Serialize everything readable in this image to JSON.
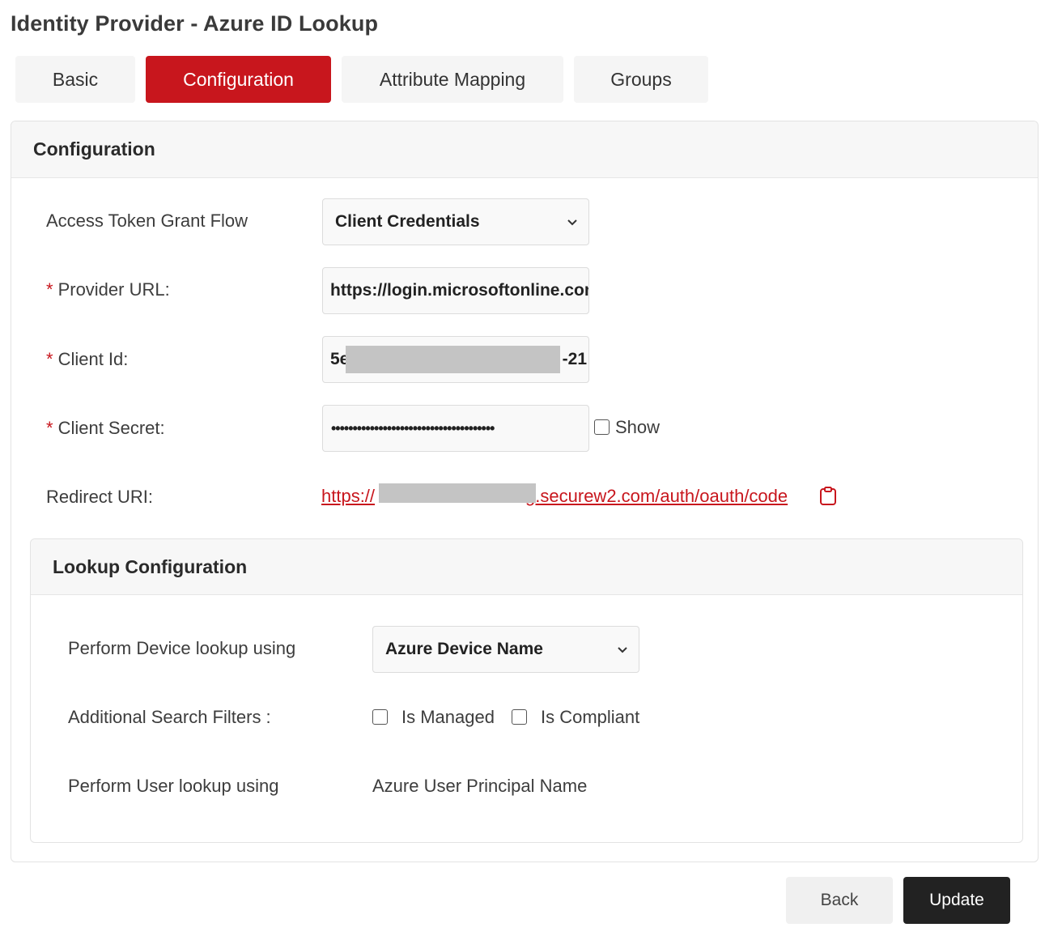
{
  "page": {
    "title": "Identity Provider - Azure ID Lookup"
  },
  "tabs": [
    {
      "label": "Basic",
      "active": false
    },
    {
      "label": "Configuration",
      "active": true
    },
    {
      "label": "Attribute Mapping",
      "active": false
    },
    {
      "label": "Groups",
      "active": false
    }
  ],
  "configuration": {
    "header": "Configuration",
    "grant_flow": {
      "label": "Access Token Grant Flow",
      "value": "Client Credentials"
    },
    "provider_url": {
      "required_mark": "*",
      "label": "Provider URL:",
      "value": "https://login.microsoftonline.com"
    },
    "client_id": {
      "required_mark": "*",
      "label": "Client Id:",
      "prefix": "5e",
      "suffix": "-21"
    },
    "client_secret": {
      "required_mark": "*",
      "label": "Client Secret:",
      "value": "••••••••••••••••••••••••••••••••••••••",
      "show_label": "Show"
    },
    "redirect_uri": {
      "label": "Redirect URI:",
      "prefix": "https://",
      "suffix": "g.securew2.com/auth/oauth/code"
    }
  },
  "lookup": {
    "header": "Lookup Configuration",
    "device_lookup": {
      "label": "Perform Device lookup using",
      "value": "Azure Device Name"
    },
    "search_filters": {
      "label": "Additional Search Filters :",
      "is_managed": "Is Managed",
      "is_compliant": "Is Compliant"
    },
    "user_lookup": {
      "label": "Perform User lookup using",
      "value": "Azure User Principal Name"
    }
  },
  "actions": {
    "back": "Back",
    "update": "Update"
  },
  "colors": {
    "accent": "#c8161d",
    "dark_button": "#222222"
  }
}
